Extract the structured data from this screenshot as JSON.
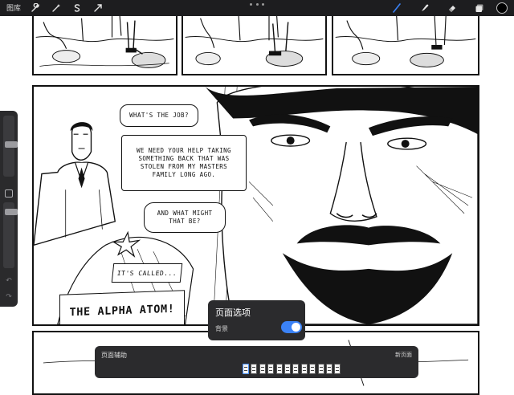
{
  "toolbar": {
    "gallery_label": "图库",
    "left_tools": [
      "wrench-icon",
      "magic-wand-icon",
      "selection-icon",
      "transform-icon"
    ],
    "right_tools": [
      "brush-icon",
      "smudge-icon",
      "eraser-icon",
      "layers-icon"
    ],
    "active_tool": "brush-icon",
    "current_color": "#000000",
    "accent": "#3b82f6"
  },
  "comic": {
    "balloons": [
      "WHAT'S THE JOB?",
      "WE NEED YOUR HELP TAKING SOMETHING BACK THAT WAS STOLEN FROM MY MASTERS FAMILY LONG AGO.",
      "AND WHAT MIGHT THAT BE?",
      "IT'S CALLED..."
    ],
    "caption": "THE ALPHA ATOM!"
  },
  "page_options": {
    "title": "页面选项",
    "background_label": "背景",
    "background_enabled": true
  },
  "page_assist": {
    "label": "页面辅助",
    "new_page": "新页面",
    "pages": 12,
    "active_page": 1
  }
}
